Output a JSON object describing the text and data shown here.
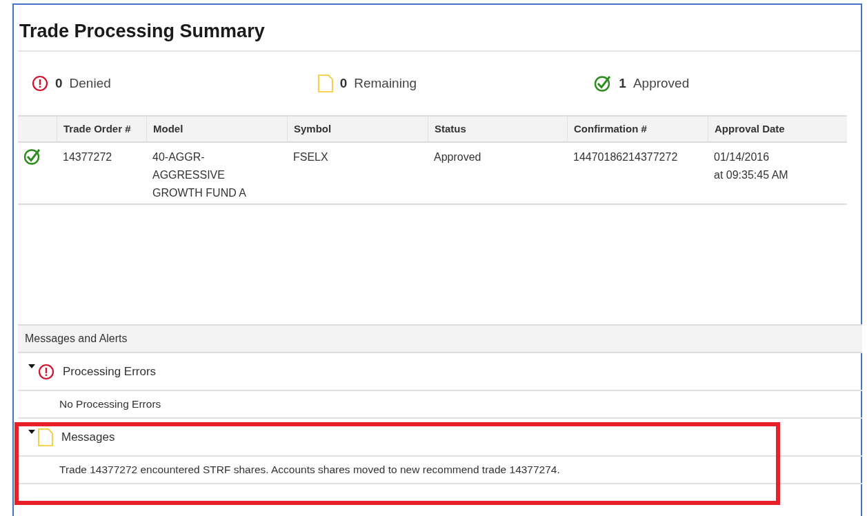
{
  "title": "Trade Processing Summary",
  "stats": [
    {
      "kind": "denied",
      "count": "0",
      "label": "Denied"
    },
    {
      "kind": "remaining",
      "count": "0",
      "label": "Remaining"
    },
    {
      "kind": "approved",
      "count": "1",
      "label": "Approved"
    }
  ],
  "table": {
    "columns": [
      "Trade Order #",
      "Model",
      "Symbol",
      "Status",
      "Confirmation #",
      "Approval Date"
    ],
    "rows": [
      {
        "kind": "approved",
        "cells": [
          "14377272",
          "40-AGGR-\nAGGRESSIVE\nGROWTH FUND A",
          "FSELX",
          "Approved",
          "14470186214377272",
          "01/14/2016\nat 09:35:45 AM"
        ]
      }
    ]
  },
  "messages_panel": {
    "title": "Messages and Alerts",
    "sections": [
      {
        "kind": "error",
        "title": "Processing Errors",
        "expanded": true,
        "items": [
          "No Processing Errors"
        ]
      },
      {
        "kind": "message",
        "title": "Messages",
        "expanded": true,
        "items": [
          "Trade 14377272 encountered STRF shares. Accounts shares moved to new recommend trade 14377274."
        ]
      }
    ]
  }
}
